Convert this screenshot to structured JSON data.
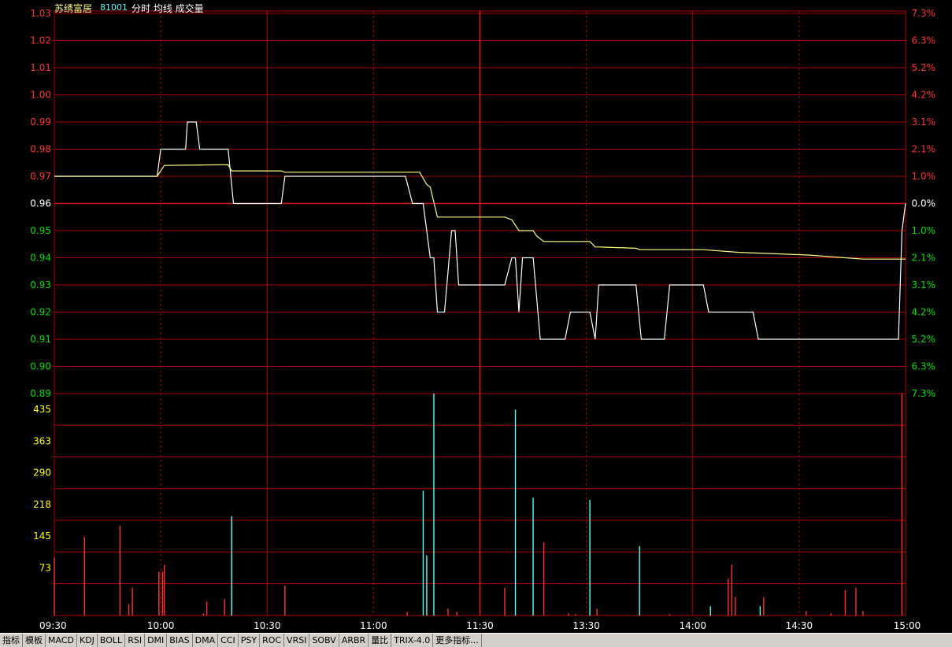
{
  "header": {
    "stock_name": "苏绣富居",
    "stock_code": "81001",
    "chart_label": "分时 均线 成交量"
  },
  "colors": {
    "background": "#000000",
    "grid": "#b00000",
    "price_line": "#ffffff",
    "avg_line": "#ffff80",
    "up": "#ff3232",
    "down": "#00e000",
    "flat": "#ffffff",
    "volume_up": "#ff3232",
    "volume_down": "#54ffff",
    "volume_label": "#ffff00",
    "time_label": "#ffffff"
  },
  "tabs": [
    "指标",
    "模板",
    "MACD",
    "KDJ",
    "BOLL",
    "RSI",
    "DMI",
    "BIAS",
    "DMA",
    "CCI",
    "PSY",
    "ROC",
    "VRSI",
    "SOBV",
    "ARBR",
    "量比",
    "TRIX-4.0",
    "更多指标..."
  ],
  "chart_data": [
    {
      "type": "line",
      "title": "分时 均线",
      "price_axis": [
        "1.03",
        "1.02",
        "1.01",
        "1.00",
        "0.99",
        "0.98",
        "0.97",
        "0.96",
        "0.95",
        "0.94",
        "0.93",
        "0.92",
        "0.91",
        "0.90",
        "0.89"
      ],
      "pct_axis": [
        "7.3%",
        "6.3%",
        "5.2%",
        "4.2%",
        "3.1%",
        "2.1%",
        "1.0%",
        "0.0%",
        "1.0%",
        "2.1%",
        "3.1%",
        "4.2%",
        "5.2%",
        "6.3%",
        "7.3%"
      ],
      "ylim": [
        0.89,
        1.03
      ],
      "base_price": 0.96,
      "x_labels": [
        "09:30",
        "10:00",
        "10:30",
        "11:00",
        "11:30",
        "13:30",
        "14:00",
        "14:30",
        "15:00"
      ],
      "xlim": [
        0,
        240
      ],
      "series": [
        {
          "points": [
            [
              0,
              0.97
            ],
            [
              29,
              0.97
            ],
            [
              30,
              0.98
            ],
            [
              37,
              0.98
            ],
            [
              37.5,
              0.99
            ],
            [
              40,
              0.99
            ],
            [
              41,
              0.98
            ],
            [
              49,
              0.98
            ],
            [
              50.5,
              0.96
            ],
            [
              64,
              0.96
            ],
            [
              65,
              0.97
            ],
            [
              99,
              0.97
            ],
            [
              101,
              0.96
            ],
            [
              104,
              0.96
            ],
            [
              106,
              0.94
            ],
            [
              107,
              0.94
            ],
            [
              108,
              0.92
            ],
            [
              110,
              0.92
            ],
            [
              112,
              0.95
            ],
            [
              113,
              0.95
            ],
            [
              114,
              0.93
            ],
            [
              127,
              0.93
            ],
            [
              129,
              0.94
            ],
            [
              130,
              0.94
            ],
            [
              131,
              0.92
            ],
            [
              132,
              0.94
            ],
            [
              135,
              0.94
            ],
            [
              137,
              0.91
            ],
            [
              144,
              0.91
            ],
            [
              145.5,
              0.92
            ],
            [
              151,
              0.92
            ],
            [
              152.5,
              0.91
            ],
            [
              153.5,
              0.93
            ],
            [
              164,
              0.93
            ],
            [
              165.5,
              0.91
            ],
            [
              172,
              0.91
            ],
            [
              173.5,
              0.93
            ],
            [
              183,
              0.93
            ],
            [
              184.5,
              0.92
            ],
            [
              197,
              0.92
            ],
            [
              198.5,
              0.91
            ],
            [
              238,
              0.91
            ],
            [
              239,
              0.95
            ],
            [
              240,
              0.96
            ]
          ]
        },
        {
          "points": [
            [
              0,
              0.97
            ],
            [
              29,
              0.97
            ],
            [
              31,
              0.974
            ],
            [
              49,
              0.9743
            ],
            [
              50,
              0.972
            ],
            [
              64,
              0.972
            ],
            [
              65,
              0.9715
            ],
            [
              103,
              0.9715
            ],
            [
              105,
              0.967
            ],
            [
              106,
              0.966
            ],
            [
              108,
              0.955
            ],
            [
              127,
              0.955
            ],
            [
              129,
              0.954
            ],
            [
              131,
              0.95
            ],
            [
              135,
              0.95
            ],
            [
              136,
              0.948
            ],
            [
              138,
              0.946
            ],
            [
              151,
              0.946
            ],
            [
              152.5,
              0.944
            ],
            [
              164,
              0.9435
            ],
            [
              165,
              0.943
            ],
            [
              183,
              0.943
            ],
            [
              193,
              0.942
            ],
            [
              213,
              0.941
            ],
            [
              228,
              0.9395
            ],
            [
              240,
              0.9395
            ]
          ]
        }
      ]
    },
    {
      "type": "bar",
      "title": "成交量",
      "y_axis": [
        "435",
        "363",
        "290",
        "218",
        "145",
        "73"
      ],
      "ylim": [
        0,
        480
      ],
      "xlim": [
        0,
        240
      ],
      "bars": [
        [
          0,
          125,
          "up"
        ],
        [
          8.5,
          170,
          "up"
        ],
        [
          18.5,
          195,
          "up"
        ],
        [
          21,
          25,
          "up"
        ],
        [
          22,
          60,
          "up"
        ],
        [
          29.5,
          95,
          "up"
        ],
        [
          30.5,
          95,
          "up"
        ],
        [
          31,
          110,
          "up"
        ],
        [
          42,
          5,
          "up"
        ],
        [
          43,
          30,
          "up"
        ],
        [
          48,
          35,
          "up"
        ],
        [
          50,
          215,
          "down"
        ],
        [
          65,
          65,
          "up"
        ],
        [
          99.5,
          8,
          "up"
        ],
        [
          104,
          270,
          "down"
        ],
        [
          105,
          130,
          "down"
        ],
        [
          107,
          480,
          "down"
        ],
        [
          111,
          15,
          "up"
        ],
        [
          113.5,
          8,
          "up"
        ],
        [
          127,
          60,
          "up"
        ],
        [
          130,
          445,
          "down"
        ],
        [
          135,
          255,
          "down"
        ],
        [
          138,
          158,
          "up"
        ],
        [
          145,
          5,
          "up"
        ],
        [
          147,
          3,
          "up"
        ],
        [
          151,
          250,
          "down"
        ],
        [
          153,
          15,
          "up"
        ],
        [
          165,
          150,
          "down"
        ],
        [
          173.5,
          3,
          "up"
        ],
        [
          185,
          20,
          "down"
        ],
        [
          190,
          80,
          "up"
        ],
        [
          191,
          110,
          "up"
        ],
        [
          192,
          40,
          "up"
        ],
        [
          199,
          20,
          "down"
        ],
        [
          200,
          40,
          "up"
        ],
        [
          212,
          10,
          "up"
        ],
        [
          219,
          5,
          "up"
        ],
        [
          223,
          55,
          "up"
        ],
        [
          226,
          60,
          "up"
        ],
        [
          228,
          10,
          "up"
        ],
        [
          239,
          480,
          "up"
        ]
      ]
    }
  ]
}
